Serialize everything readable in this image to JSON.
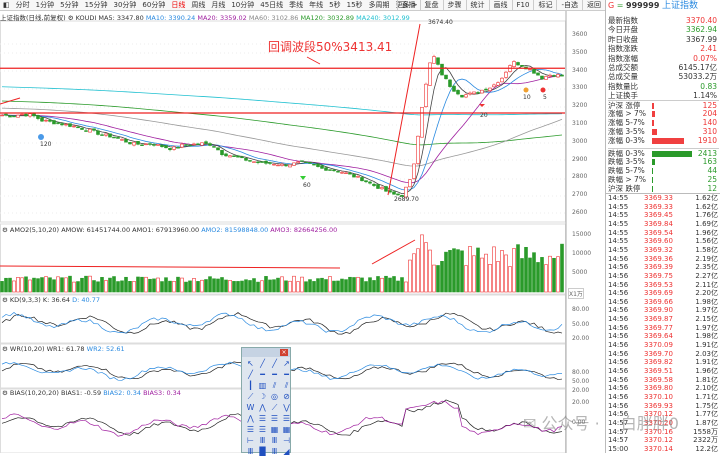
{
  "toolbar": {
    "items": [
      "分时",
      "1分钟",
      "5分钟",
      "15分钟",
      "30分钟",
      "60分钟",
      "日线",
      "周线",
      "月线",
      "10分钟",
      "45日线",
      "季线",
      "年线",
      "5秒",
      "15秒",
      "多周期",
      "更多 >"
    ],
    "active": "日线",
    "right": [
      "直播",
      "复盘",
      "步骤",
      "统计",
      "画线",
      "F10",
      "标记",
      "-自选",
      "返回"
    ]
  },
  "info": {
    "name": "上证指数(日线,前复权)",
    "indicator": "KOUDI",
    "ma5": "MA5: 3347.80",
    "ma10": "MA10: 3390.24",
    "ma20": "MA20: 3359.02",
    "ma60": "MA60: 3102.86",
    "ma120": "MA120: 3032.89",
    "ma240": "MA240: 3012.99"
  },
  "annotations": {
    "retrace": "回调波段50%3413.41",
    "high": "3674.40",
    "low": "2689.70",
    "n120": "120",
    "n60": "60",
    "n20": "20",
    "n10": "10",
    "n5": "5"
  },
  "price_axis": [
    "3600",
    "3500",
    "3400",
    "3300",
    "3200",
    "3100",
    "3000",
    "2900",
    "2800",
    "2700",
    "2600"
  ],
  "levels": {
    "upper": 3413.41,
    "lower": 3162
  },
  "kline": {
    "closes_sampled": [
      3150,
      3145,
      3155,
      3150,
      3120,
      3110,
      3100,
      3090,
      3075,
      3060,
      3040,
      3030,
      3010,
      2990,
      2985,
      2990,
      2975,
      2960,
      2980,
      2985,
      2990,
      2985,
      2935,
      2920,
      2905,
      2890,
      2880,
      2880,
      2870,
      2875,
      2885,
      2870,
      2850,
      2845,
      2830,
      2810,
      2790,
      2760,
      2735,
      2705,
      2700,
      2800,
      3200,
      3500,
      3380,
      3300,
      3260,
      3270,
      3290,
      3310,
      3360,
      3450,
      3430,
      3400,
      3360,
      3380,
      3370
    ]
  },
  "amo": {
    "label": "AMO2(5,10,20)",
    "amow": "AMOW: 61451744.00",
    "amo1": "AMO1: 67913960.00",
    "amo2": "AMO2: 81598848.00",
    "amo3": "AMO3: 82664256.00",
    "axis": [
      "15000",
      "10000",
      "5000"
    ],
    "unit": "X1万"
  },
  "kd": {
    "label": "KD(9,3,3)",
    "k": "K: 36.64",
    "d": "D: 40.77",
    "axis": [
      "80.00",
      "50.00",
      "20.00"
    ]
  },
  "wr": {
    "label": "WR(10,20)",
    "wr1": "WR1: 61.78",
    "wr2": "WR2: 52.61",
    "axis": [
      "80.00",
      "50.00",
      "20.00"
    ]
  },
  "bias": {
    "label": "BIAS(10,20,20)",
    "b1": "BIAS1: -0.59",
    "b2": "BIAS2: 0.34",
    "b3": "BIAS3: 0.34",
    "axis": [
      "20.00",
      "0.00"
    ]
  },
  "panel": {
    "g": "G",
    "eq": "=",
    "code": "999999",
    "name": "上证指数",
    "stats": [
      {
        "k": "最新指数",
        "v": "3370.40",
        "c": "red"
      },
      {
        "k": "今日开盘",
        "v": "3362.94",
        "c": "green"
      },
      {
        "k": "昨日收盘",
        "v": "3367.99",
        "c": ""
      },
      {
        "k": "指数涨跌",
        "v": "2.41",
        "c": "red"
      },
      {
        "k": "指数涨幅",
        "v": "0.07%",
        "c": "red"
      },
      {
        "k": "总成交额",
        "v": "6145.17亿",
        "c": ""
      },
      {
        "k": "总成交量",
        "v": "53033.2万",
        "c": ""
      },
      {
        "k": "指数量比",
        "v": "0.83",
        "c": "green"
      },
      {
        "k": "上证换手",
        "v": "1.14%",
        "c": ""
      }
    ],
    "breadth": [
      {
        "k": "沪深 涨停",
        "v": "125",
        "n": 125,
        "c": "red"
      },
      {
        "k": "涨幅 > 7%",
        "v": "204",
        "n": 204,
        "c": "red"
      },
      {
        "k": "涨幅 5-7%",
        "v": "140",
        "n": 140,
        "c": "red"
      },
      {
        "k": "涨幅 3-5%",
        "v": "310",
        "n": 310,
        "c": "red"
      },
      {
        "k": "涨幅 0-3%",
        "v": "1910",
        "n": 1910,
        "c": "red"
      },
      {
        "k": "跌幅 0-3%",
        "v": "2413",
        "n": 2413,
        "c": "green"
      },
      {
        "k": "跌幅 3-5%",
        "v": "163",
        "n": 163,
        "c": "green"
      },
      {
        "k": "跌幅 5-7%",
        "v": "44",
        "n": 44,
        "c": "green"
      },
      {
        "k": "跌幅 > 7%",
        "v": "25",
        "n": 25,
        "c": "green"
      },
      {
        "k": "沪深 跌停",
        "v": "12",
        "n": 12,
        "c": "green"
      }
    ],
    "ticks": [
      [
        "14:55",
        "3369.33",
        "1.62亿"
      ],
      [
        "14:55",
        "3369.33",
        "1.62亿"
      ],
      [
        "14:55",
        "3369.45",
        "1.76亿"
      ],
      [
        "14:55",
        "3369.84",
        "1.69亿"
      ],
      [
        "14:55",
        "3369.54",
        "1.96亿"
      ],
      [
        "14:55",
        "3369.60",
        "1.56亿"
      ],
      [
        "14:55",
        "3369.32",
        "1.58亿"
      ],
      [
        "14:56",
        "3369.36",
        "2.19亿"
      ],
      [
        "14:56",
        "3369.39",
        "2.35亿"
      ],
      [
        "14:56",
        "3369.75",
        "2.27亿"
      ],
      [
        "14:56",
        "3369.53",
        "2.11亿"
      ],
      [
        "14:56",
        "3369.69",
        "2.20亿"
      ],
      [
        "14:56",
        "3369.66",
        "1.98亿"
      ],
      [
        "14:56",
        "3369.90",
        "1.97亿"
      ],
      [
        "14:56",
        "3369.87",
        "2.15亿"
      ],
      [
        "14:56",
        "3369.77",
        "1.97亿"
      ],
      [
        "14:56",
        "3369.64",
        "1.98亿"
      ],
      [
        "14:56",
        "3370.09",
        "1.91亿"
      ],
      [
        "14:56",
        "3369.70",
        "2.03亿"
      ],
      [
        "14:56",
        "3369.82",
        "1.91亿"
      ],
      [
        "14:56",
        "3369.51",
        "1.96亿"
      ],
      [
        "14:56",
        "3369.58",
        "1.81亿"
      ],
      [
        "14:56",
        "3369.80",
        "2.10亿"
      ],
      [
        "14:56",
        "3370.10",
        "1.71亿"
      ],
      [
        "14:56",
        "3369.93",
        "1.75亿"
      ],
      [
        "14:56",
        "3370.12",
        "1.77亿"
      ],
      [
        "14:57",
        "3370.20",
        "1.87亿"
      ],
      [
        "14:57",
        "3370.16",
        "1558万"
      ],
      [
        "14:57",
        "3370.12",
        "2322万"
      ],
      [
        "15:00",
        "3370.14",
        "12.2亿"
      ]
    ]
  },
  "palette_icons": [
    "↖",
    "╱",
    "╱",
    "↗",
    "╱",
    "━",
    "━",
    "━",
    "┃",
    "▥",
    "⫽",
    "⫽",
    "⟋",
    "☽",
    "◎",
    "⊘",
    "W",
    "⋀",
    "⟋",
    "⋁",
    "⋀",
    "☰",
    "☰",
    "☰",
    "☰",
    "☰",
    "▦",
    "▦",
    "⊢",
    "Ⅲ",
    "Ⅲ",
    "⊣",
    "Ⅲ",
    "█",
    "Ⅲ",
    "◢"
  ],
  "watermark": {
    "text1": "公众号 ·",
    "text2": "白胖胖0"
  },
  "colors": {
    "up": "#e33",
    "down": "#2a9a2a",
    "ma5": "#444",
    "ma10": "#2a8ae0",
    "ma20": "#a020a0",
    "ma60": "#999",
    "ma120": "#2a9a2a",
    "ma240": "#20c0d0"
  }
}
